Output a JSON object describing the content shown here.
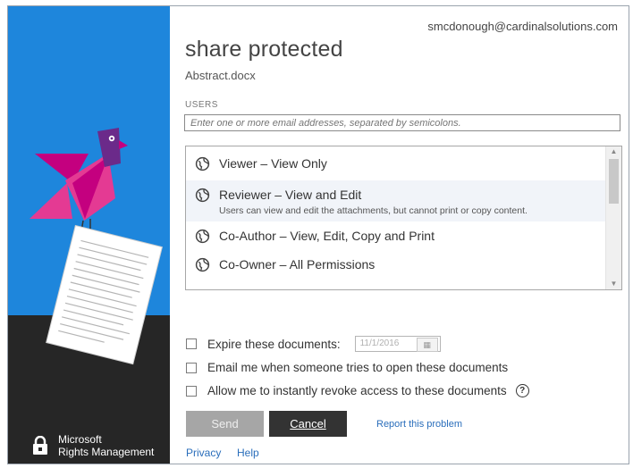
{
  "account": {
    "email": "smcdonough@cardinalsolutions.com"
  },
  "header": {
    "title": "share protected",
    "filename": "Abstract.docx"
  },
  "users": {
    "label": "USERS",
    "placeholder": "Enter one or more email addresses, separated by semicolons."
  },
  "permissions": [
    {
      "label": "Viewer – View Only",
      "description": "",
      "selected": false
    },
    {
      "label": "Reviewer – View and Edit",
      "description": "Users can view and edit the attachments, but cannot print or copy content.",
      "selected": true
    },
    {
      "label": "Co-Author – View, Edit, Copy and Print",
      "description": "",
      "selected": false
    },
    {
      "label": "Co-Owner – All Permissions",
      "description": "",
      "selected": false
    }
  ],
  "options": {
    "expire": {
      "label": "Expire these documents:",
      "checked": false,
      "date_value": "11/1/2016"
    },
    "email_me": {
      "label": "Email me when someone tries to open these documents",
      "checked": false
    },
    "revoke": {
      "label": "Allow me to instantly revoke access to these documents",
      "checked": false
    }
  },
  "buttons": {
    "send": "Send",
    "cancel": "Cancel"
  },
  "links": {
    "report": "Report this problem",
    "privacy": "Privacy",
    "help": "Help"
  },
  "brand": {
    "line1": "Microsoft",
    "line2": "Rights Management"
  },
  "icons": {
    "permission": "globe-icon",
    "help": "question-circle-icon",
    "calendar": "calendar-icon",
    "brand": "lock-icon"
  },
  "colors": {
    "left_panel_blue": "#1e86dc",
    "left_panel_dark": "#262626",
    "bird_magenta": "#c4007f",
    "bird_pink": "#e43a93",
    "bird_purple": "#6b2a8a",
    "send_disabled": "#a6a6a6",
    "cancel_dark": "#333333",
    "link_blue": "#2a6ebb"
  }
}
